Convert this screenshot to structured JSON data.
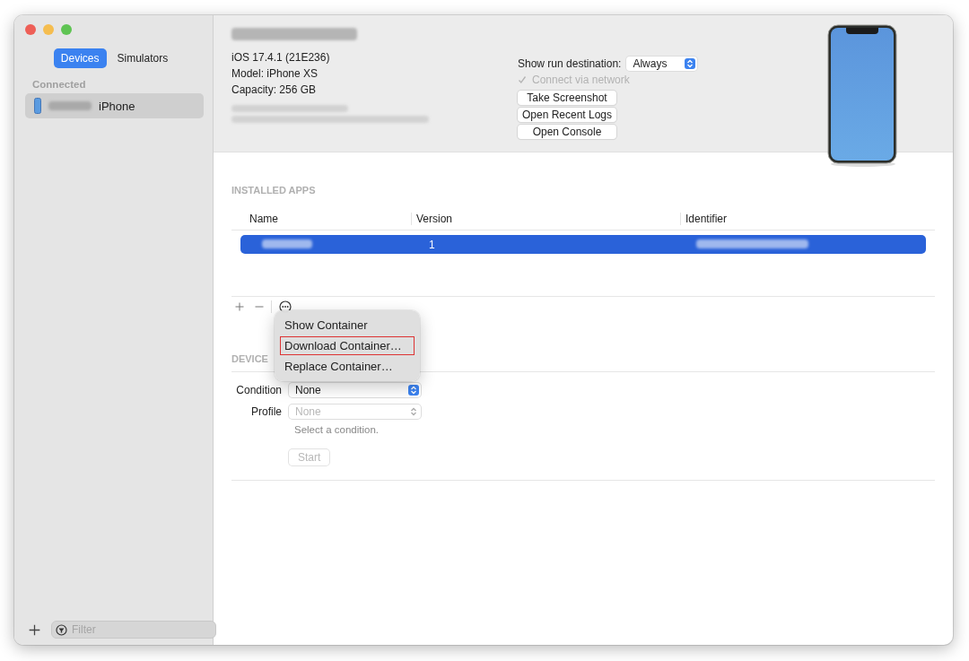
{
  "sidebar": {
    "tabs": [
      {
        "label": "Devices",
        "selected": true
      },
      {
        "label": "Simulators",
        "selected": false
      }
    ],
    "section": "Connected",
    "devices": [
      {
        "name": "iPhone",
        "selected": true
      }
    ],
    "filter": {
      "placeholder": "Filter"
    }
  },
  "device": {
    "info": [
      "iOS 17.4.1 (21E236)",
      "Model: iPhone XS",
      "Capacity: 256 GB"
    ],
    "run_destination": {
      "label": "Show run destination:",
      "value": "Always"
    },
    "connect_network": {
      "label": "Connect via network",
      "checked": true,
      "disabled": true
    },
    "buttons": [
      "Take Screenshot",
      "Open Recent Logs",
      "Open Console"
    ]
  },
  "installed_apps": {
    "title": "INSTALLED APPS",
    "columns": [
      "Name",
      "Version",
      "Identifier"
    ],
    "rows": [
      {
        "version": "1",
        "selected": true
      }
    ]
  },
  "actions_menu": {
    "items": [
      {
        "label": "Show Container",
        "highlighted": false
      },
      {
        "label": "Download Container…",
        "highlighted": true
      },
      {
        "label": "Replace Container…",
        "highlighted": false
      }
    ]
  },
  "device_conditions": {
    "title": "DEVICE",
    "condition": {
      "label": "Condition",
      "value": "None",
      "disabled": false
    },
    "profile": {
      "label": "Profile",
      "value": "None",
      "disabled": true
    },
    "hint": "Select a condition.",
    "start": {
      "label": "Start",
      "disabled": true
    }
  }
}
